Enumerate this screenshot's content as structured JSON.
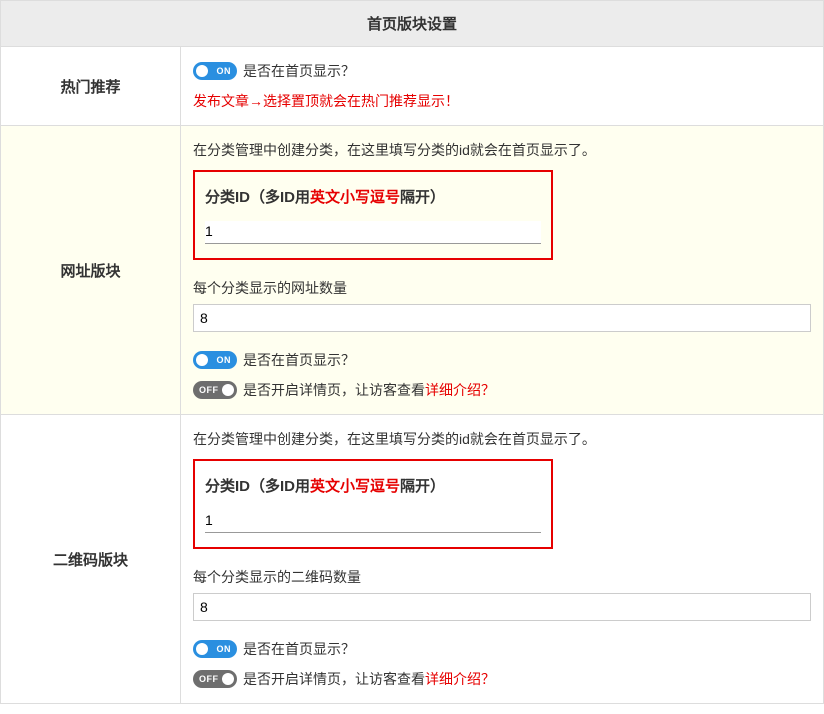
{
  "header": {
    "title": "首页版块设置"
  },
  "section_hot": {
    "label": "热门推荐",
    "toggle_show": {
      "state": "ON",
      "label": "是否在首页显示？"
    },
    "tip": "发布文章→选择置顶就会在热门推荐显示！"
  },
  "section_url": {
    "label": "网址版块",
    "desc": "在分类管理中创建分类，在这里填写分类的id就会在首页显示了。",
    "cat_id_prefix": "分类ID（多ID用",
    "cat_id_red": "英文小写逗号",
    "cat_id_suffix": "隔开）",
    "cat_id_value": "1",
    "per_label": "每个分类显示的网址数量",
    "per_value": "8",
    "toggle_show": {
      "state": "ON",
      "label": "是否在首页显示？"
    },
    "toggle_detail": {
      "state": "OFF",
      "label_prefix": "是否开启详情页，让访客查看",
      "label_red": "详细介绍",
      "q": "？"
    }
  },
  "section_qr": {
    "label": "二维码版块",
    "desc": "在分类管理中创建分类，在这里填写分类的id就会在首页显示了。",
    "cat_id_prefix": "分类ID（多ID用",
    "cat_id_red": "英文小写逗号",
    "cat_id_suffix": "隔开）",
    "cat_id_value": "1",
    "per_label": "每个分类显示的二维码数量",
    "per_value": "8",
    "toggle_show": {
      "state": "ON",
      "label": "是否在首页显示？"
    },
    "toggle_detail": {
      "state": "OFF",
      "label_prefix": "是否开启详情页，让访客查看",
      "label_red": "详细介绍",
      "q": "？"
    }
  }
}
